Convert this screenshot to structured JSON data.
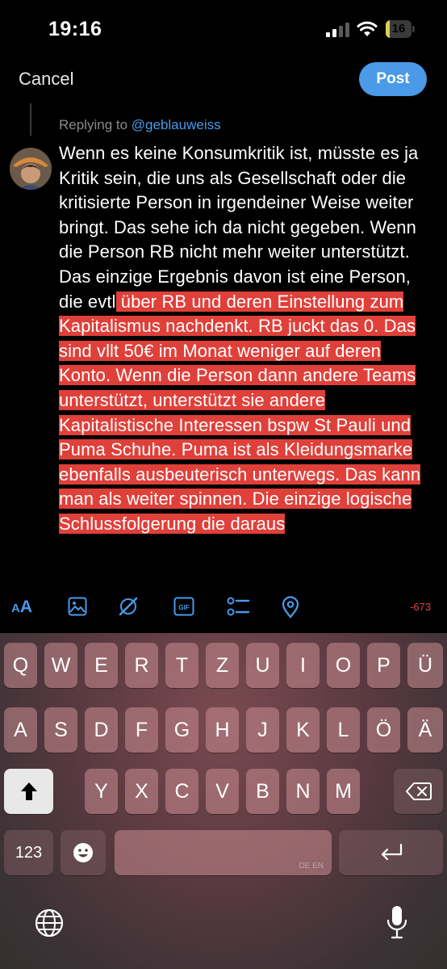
{
  "status_bar": {
    "time": "19:16",
    "battery_level": "16"
  },
  "header": {
    "cancel_label": "Cancel",
    "post_label": "Post"
  },
  "reply": {
    "prefix": "Replying to ",
    "handle": "@geblauweiss"
  },
  "compose": {
    "text_within_limit": "Wenn es keine Konsumkritik ist, müsste es ja Kritik sein, die uns als Gesellschaft oder die kritisierte Person in irgendeiner Weise weiter bringt. Das sehe ich da nicht gegeben. Wenn die Person RB nicht mehr weiter unterstützt. Das einzige Ergebnis davon ist eine Person, die evtl",
    "text_over_limit": " über RB und deren Einstellung zum Kapitalismus nachdenkt. RB juckt das 0. Das sind vllt 50€ im Monat weniger auf deren Konto. Wenn die Person dann andere Teams unterstützt, unterstützt sie andere Kapitalistische Interessen bspw St Pauli und Puma Schuhe. Puma ist als Kleidungsmarke ebenfalls ausbeuterisch unterwegs. Das kann man als weiter spinnen. Die einzige logische Schlussfolgerung die daraus"
  },
  "toolbar": {
    "text_size_label": "AA",
    "gif_label": "GIF",
    "char_counter": "-673",
    "icons": [
      "text-size-icon",
      "image-icon",
      "alt-icon",
      "gif-icon",
      "poll-icon",
      "location-icon"
    ]
  },
  "keyboard": {
    "row1": [
      "Q",
      "W",
      "E",
      "R",
      "T",
      "Z",
      "U",
      "I",
      "O",
      "P",
      "Ü"
    ],
    "row2": [
      "A",
      "S",
      "D",
      "F",
      "G",
      "H",
      "J",
      "K",
      "L",
      "Ö",
      "Ä"
    ],
    "row3": [
      "Y",
      "X",
      "C",
      "V",
      "B",
      "N",
      "M"
    ],
    "numbers_label": "123",
    "space_languages": "DE EN"
  },
  "colors": {
    "accent": "#4a9ae8",
    "over_limit_highlight": "#e0403a",
    "counter": "#e04040",
    "battery": "#d9d05c"
  }
}
